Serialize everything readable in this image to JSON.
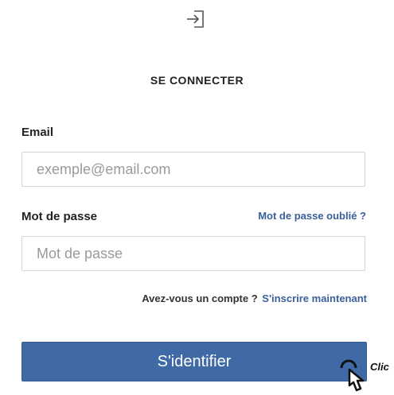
{
  "header": {
    "icon": "sign-in-icon",
    "title": "SE CONNECTER"
  },
  "form": {
    "email_label": "Email",
    "email_placeholder": "exemple@email.com",
    "email_value": "",
    "password_label": "Mot de passe",
    "password_placeholder": "Mot de passe",
    "password_value": "",
    "forgot_link": "Mot de passe oublié ?",
    "account_prompt": "Avez-vous un compte ?",
    "signup_link": "S'inscrire maintenant",
    "submit_label": "S'identifier"
  },
  "hint": {
    "text": "Clic",
    "icon": "hand-pointer-icon"
  },
  "colors": {
    "primary": "#3f6aa5",
    "link": "#3a5f99",
    "input_border": "#d4d4d4"
  }
}
